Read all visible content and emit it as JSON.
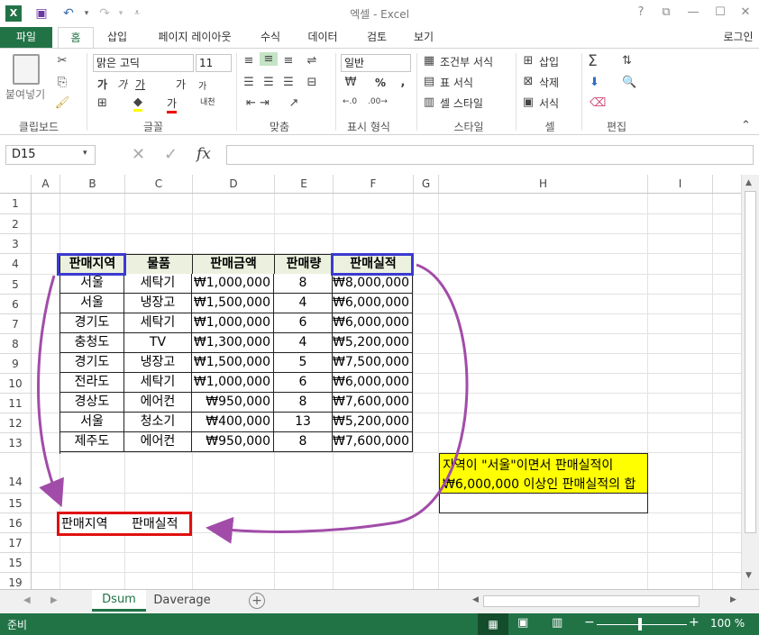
{
  "window": {
    "title": "엑셀 - Excel",
    "signin": "로그인"
  },
  "tabs": [
    "파일",
    "홈",
    "삽입",
    "페이지 레이아웃",
    "수식",
    "데이터",
    "검토",
    "보기"
  ],
  "ribbon": {
    "clipboard": {
      "paste": "붙여넣기",
      "group": "클립보드"
    },
    "font": {
      "name": "맑은 고딕",
      "size": "11",
      "group": "글꼴",
      "bold": "가",
      "italic": "가",
      "underline": "가",
      "grow": "가",
      "shrink": "가",
      "phonetic": "내천"
    },
    "align": {
      "group": "맞춤"
    },
    "number": {
      "format": "일반",
      "group": "표시 형식",
      "percent": "%"
    },
    "styles": {
      "cond": "조건부 서식",
      "table": "표 서식",
      "cell": "셀 스타일",
      "group": "스타일"
    },
    "cells": {
      "insert": "삽입",
      "delete": "삭제",
      "format": "서식",
      "group": "셀"
    },
    "edit": {
      "group": "편집"
    }
  },
  "formula_bar": {
    "name_box": "D15",
    "formula": ""
  },
  "columns": [
    "A",
    "B",
    "C",
    "D",
    "E",
    "F",
    "G",
    "H",
    "I"
  ],
  "rows": [
    "1",
    "2",
    "3",
    "4",
    "5",
    "6",
    "7",
    "8",
    "9",
    "10",
    "11",
    "12",
    "13",
    "14",
    "15",
    "16",
    "17",
    "15",
    "19"
  ],
  "table": {
    "headers": [
      "판매지역",
      "물품",
      "판매금액",
      "판매량",
      "판매실적"
    ],
    "rows": [
      [
        "서울",
        "세탁기",
        "₩1,000,000",
        "8",
        "₩8,000,000"
      ],
      [
        "서울",
        "냉장고",
        "₩1,500,000",
        "4",
        "₩6,000,000"
      ],
      [
        "경기도",
        "세탁기",
        "₩1,000,000",
        "6",
        "₩6,000,000"
      ],
      [
        "충청도",
        "TV",
        "₩1,300,000",
        "4",
        "₩5,200,000"
      ],
      [
        "경기도",
        "냉장고",
        "₩1,500,000",
        "5",
        "₩7,500,000"
      ],
      [
        "전라도",
        "세탁기",
        "₩1,000,000",
        "6",
        "₩6,000,000"
      ],
      [
        "경상도",
        "에어컨",
        "₩950,000",
        "8",
        "₩7,600,000"
      ],
      [
        "서울",
        "청소기",
        "₩400,000",
        "13",
        "₩5,200,000"
      ],
      [
        "제주도",
        "에어컨",
        "₩950,000",
        "8",
        "₩7,600,000"
      ]
    ]
  },
  "criteria": {
    "h1": "판매지역",
    "h2": "판매실적"
  },
  "note": {
    "line1": "지역이 \"서울\"이면서 판매실적이",
    "line2": "₩6,000,000 이상인 판매실적의 합"
  },
  "sheets": {
    "active": "Dsum",
    "other": "Daverage"
  },
  "status": {
    "ready": "준비",
    "zoom": "100 %"
  },
  "colors": {
    "excel_green": "#217346",
    "header_fill": "#ebf1de",
    "note_fill": "#ffff00",
    "blue_box": "#3b3bcf",
    "red_box": "#e01010",
    "arrow": "#a24ca9"
  },
  "icons": [
    "excel-logo-icon",
    "save-icon",
    "undo-icon",
    "redo-icon",
    "customize-icon",
    "help-icon",
    "ribbon-display-icon",
    "minimize-icon",
    "maximize-icon",
    "close-icon",
    "paste-icon",
    "cut-icon",
    "copy-icon",
    "format-painter-icon",
    "borders-icon",
    "fill-color-icon",
    "font-color-icon",
    "align-top-icon",
    "align-middle-icon",
    "align-bottom-icon",
    "wrap-text-icon",
    "align-left-icon",
    "align-center-icon",
    "align-right-icon",
    "merge-icon",
    "indent-icon",
    "currency-icon",
    "percent-icon",
    "comma-icon",
    "increase-decimal-icon",
    "decrease-decimal-icon",
    "conditional-format-icon",
    "table-format-icon",
    "cell-styles-icon",
    "insert-cells-icon",
    "delete-cells-icon",
    "format-cells-icon",
    "autosum-icon",
    "fill-icon",
    "clear-icon",
    "sort-filter-icon",
    "find-select-icon",
    "cancel-icon",
    "enter-icon",
    "function-icon",
    "new-sheet-icon",
    "normal-view-icon",
    "page-layout-icon",
    "page-break-icon"
  ]
}
